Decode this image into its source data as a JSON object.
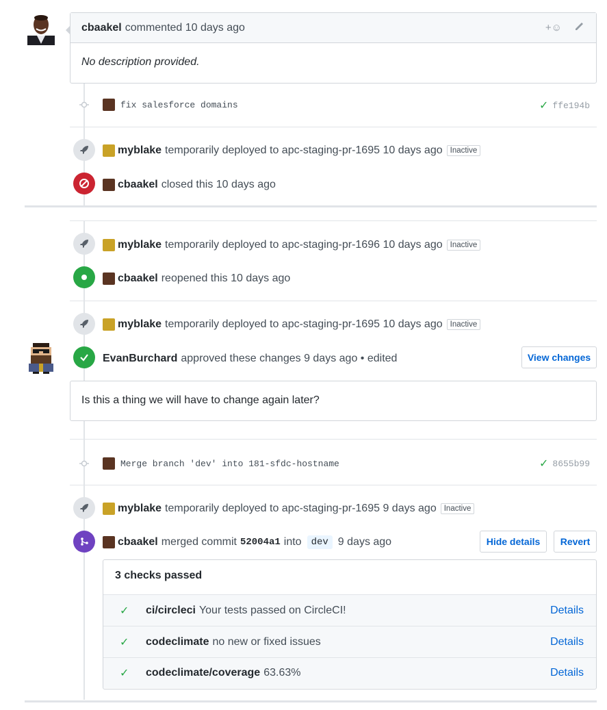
{
  "comment1": {
    "author": "cbaakel",
    "action": "commented 10 days ago",
    "body": "No description provided.",
    "emoji_label": "+☺"
  },
  "commit1": {
    "message": "fix salesforce domains",
    "sha": "ffe194b"
  },
  "deploy1": {
    "actor": "myblake",
    "text": "temporarily deployed to apc-staging-pr-1695 10 days ago",
    "status": "Inactive"
  },
  "closed": {
    "actor": "cbaakel",
    "text": "closed this 10 days ago"
  },
  "deploy2": {
    "actor": "myblake",
    "text": "temporarily deployed to apc-staging-pr-1696 10 days ago",
    "status": "Inactive"
  },
  "reopened": {
    "actor": "cbaakel",
    "text": "reopened this 10 days ago"
  },
  "deploy3": {
    "actor": "myblake",
    "text": "temporarily deployed to apc-staging-pr-1695 10 days ago",
    "status": "Inactive"
  },
  "review": {
    "author": "EvanBurchard",
    "text": "approved these changes 9 days ago • edited",
    "button": "View changes",
    "body": "Is this a thing we will have to change again later?"
  },
  "commit2": {
    "message": "Merge branch 'dev' into 181-sfdc-hostname",
    "sha": "8655b99"
  },
  "deploy4": {
    "actor": "myblake",
    "text": "temporarily deployed to apc-staging-pr-1695 9 days ago",
    "status": "Inactive"
  },
  "merged": {
    "actor": "cbaakel",
    "text1": "merged commit",
    "commit": "52004a1",
    "text2": "into",
    "branch": "dev",
    "text3": "9 days ago",
    "hide_button": "Hide details",
    "revert_button": "Revert"
  },
  "checks": {
    "summary": "3 checks passed",
    "items": [
      {
        "name": "ci/circleci",
        "desc": "Your tests passed on CircleCI!",
        "link": "Details"
      },
      {
        "name": "codeclimate",
        "desc": "no new or fixed issues",
        "link": "Details"
      },
      {
        "name": "codeclimate/coverage",
        "desc": "63.63%",
        "link": "Details"
      }
    ]
  },
  "colors": {
    "green": "#28a745",
    "red": "#cb2431",
    "purple": "#6f42c1",
    "link": "#0366d6"
  }
}
